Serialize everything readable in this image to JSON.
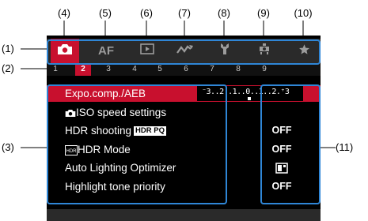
{
  "callouts": {
    "c1": "(1)",
    "c2": "(2)",
    "c3": "(3)",
    "c4": "(4)",
    "c5": "(5)",
    "c6": "(6)",
    "c7": "(7)",
    "c8": "(8)",
    "c9": "(9)",
    "c10": "(10)",
    "c11": "(11)"
  },
  "tabs": [
    {
      "name": "shooting",
      "icon": "camera-icon"
    },
    {
      "name": "af",
      "label": "AF"
    },
    {
      "name": "playback",
      "icon": "playback-icon"
    },
    {
      "name": "wireless",
      "icon": "wireless-icon"
    },
    {
      "name": "setup",
      "icon": "wrench-icon"
    },
    {
      "name": "custom",
      "icon": "custom-functions-icon"
    },
    {
      "name": "my-menu",
      "icon": "star-icon"
    }
  ],
  "active_tab": "shooting",
  "pages": [
    "1",
    "2",
    "3",
    "4",
    "5",
    "6",
    "7",
    "8",
    "9"
  ],
  "active_page": "2",
  "menu": {
    "items": [
      {
        "label": "Expo.comp./AEB",
        "value": ""
      },
      {
        "label": "ISO speed settings",
        "value": ""
      },
      {
        "label": "HDR shooting",
        "badge": "HDR PQ",
        "value": "OFF"
      },
      {
        "label": "HDR Mode",
        "value": "OFF"
      },
      {
        "label": "Auto Lighting Optimizer",
        "value_icon": "alo-icon"
      },
      {
        "label": "Highlight tone priority",
        "value": "OFF"
      }
    ],
    "expo_scale": "⁻3..2..1..0..1..2.⁺3"
  },
  "colors": {
    "accent": "#c8102e",
    "highlight": "#2f86d6"
  }
}
